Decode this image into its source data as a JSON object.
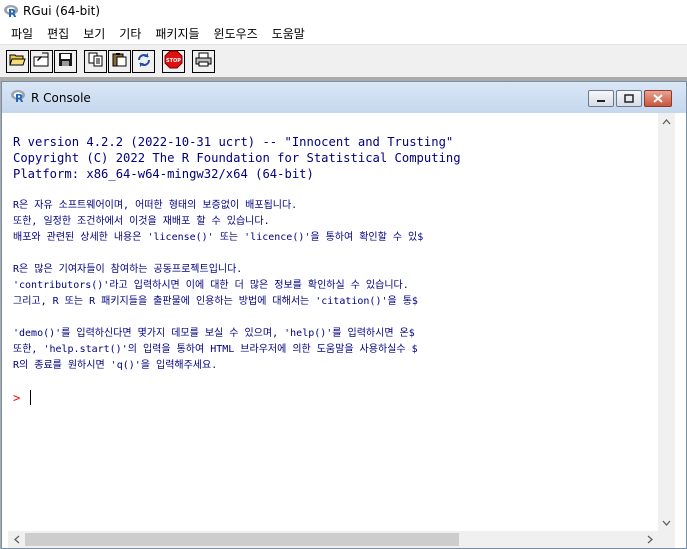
{
  "window": {
    "title": "RGui (64-bit)",
    "icon": "r-logo-icon"
  },
  "menu": [
    "파일",
    "편집",
    "보기",
    "기타",
    "패키지들",
    "윈도우즈",
    "도움말"
  ],
  "toolbar": {
    "buttons": [
      "open-script-icon",
      "load-workspace-icon",
      "save-icon",
      "copy-icon",
      "paste-icon",
      "copy-paste-icon",
      "stop-icon",
      "print-icon"
    ],
    "stop_label": "STOP"
  },
  "console_window": {
    "title": "R Console"
  },
  "console": {
    "lines": [
      "R version 4.2.2 (2022-10-31 ucrt) -- \"Innocent and Trusting\"",
      "Copyright (C) 2022 The R Foundation for Statistical Computing",
      "Platform: x86_64-w64-mingw32/x64 (64-bit)",
      "R은 자유 소프트웨어이며, 어떠한 형태의 보증없이 배포됩니다.",
      "또한, 일정한 조건하에서 이것을 재배포 할 수 있습니다.",
      "배포와 관련된 상세한 내용은 'license()' 또는 'licence()'을 통하여 확인할 수 있$",
      "R은 많은 기여자들이 참여하는 공동프로젝트입니다.",
      "'contributors()'라고 입력하시면 이에 대한 더 많은 정보를 확인하실 수 있습니다.",
      "그리고, R 또는 R 패키지들을 출판물에 인용하는 방법에 대해서는 'citation()'을 통$",
      "'demo()'를 입력하신다면 몇가지 데모를 보실 수 있으며, 'help()'를 입력하시면 온$",
      "또한, 'help.start()'의 입력을 통하여 HTML 브라우저에 의한 도움말을 사용하실수 $",
      "R의 종료를 원하시면 'q()'을 입력해주세요."
    ],
    "prompt": ">"
  }
}
